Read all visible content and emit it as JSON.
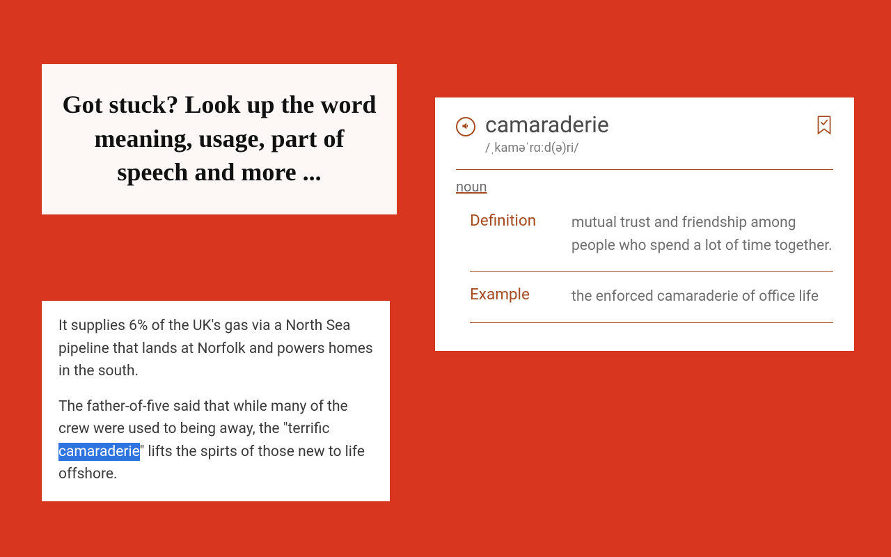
{
  "colors": {
    "background": "#d9361f",
    "accent": "#a64a20",
    "highlight": "#2d74e0"
  },
  "headline": {
    "text": "Got stuck? Look up the word meaning, usage, part of speech and more ..."
  },
  "article": {
    "para1": "It supplies 6% of the UK's gas via a North Sea pipeline that lands at Norfolk and powers homes in the south.",
    "para2_pre": "The father-of-five said that while many of the crew were used to being away, the \"terrific ",
    "para2_highlight": "camaraderie",
    "para2_post": "\" lifts the spirts of those new to life offshore."
  },
  "dictionary": {
    "word": "camaraderie",
    "pronunciation": "/ˌkaməˈrɑːd(ə)ri/",
    "part_of_speech": "noun",
    "definition_label": "Definition",
    "definition_text": "mutual trust and friendship among people who spend a lot of time together.",
    "example_label": "Example",
    "example_text": "the enforced camaraderie of office life"
  }
}
